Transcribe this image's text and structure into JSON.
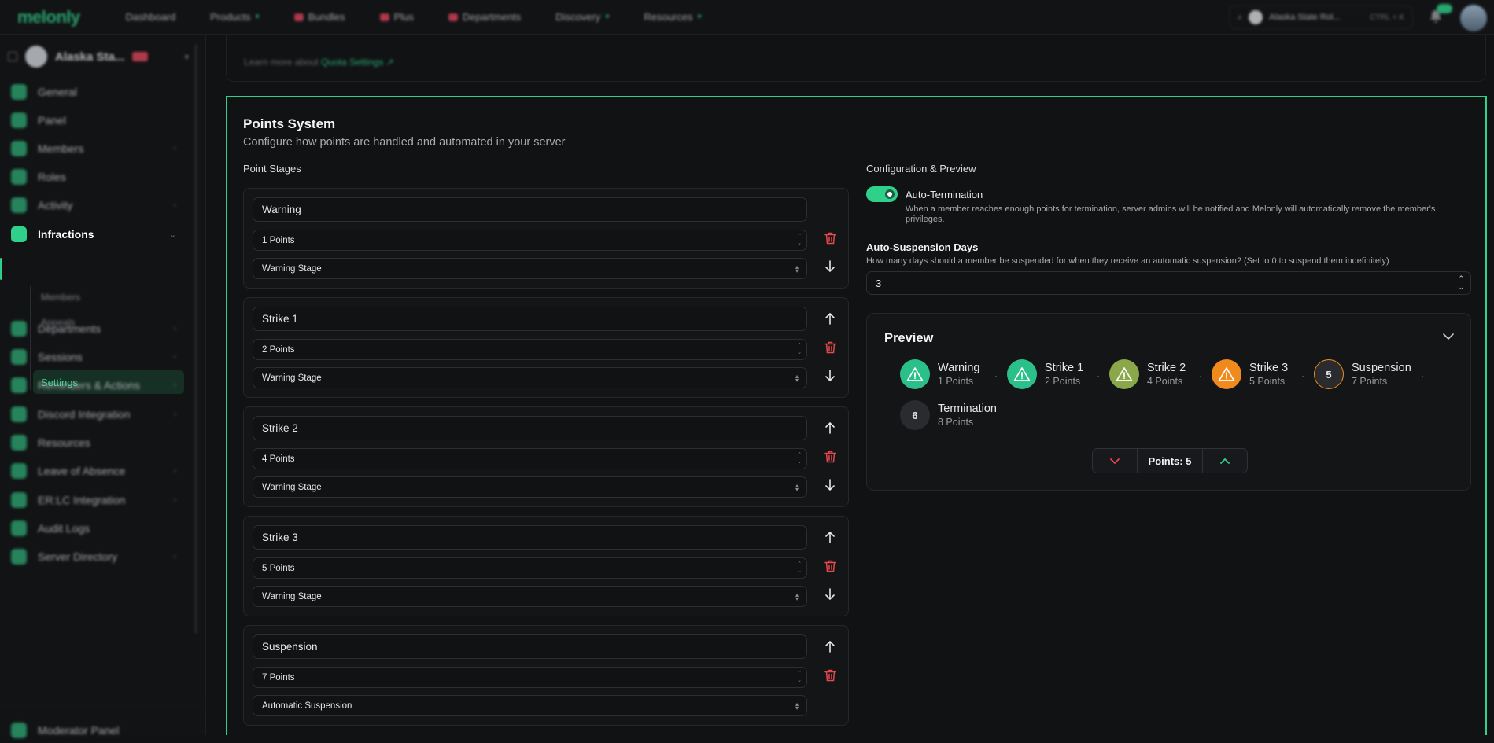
{
  "nav": {
    "logo": "melonly",
    "items": [
      {
        "label": "Dashboard"
      },
      {
        "label": "Products",
        "dropdown": true
      },
      {
        "label": "Bundles"
      },
      {
        "label": "Plus"
      },
      {
        "label": "Departments"
      },
      {
        "label": "Discovery",
        "dropdown": true
      },
      {
        "label": "Resources",
        "dropdown": true
      }
    ],
    "search": {
      "server": "Alaska State Rol...",
      "shortcut": "CTRL + K"
    }
  },
  "sidebar": {
    "server_name": "Alaska Sta...",
    "items": [
      {
        "label": "General"
      },
      {
        "label": "Panel"
      },
      {
        "label": "Members"
      },
      {
        "label": "Roles"
      },
      {
        "label": "Activity"
      },
      {
        "label": "Infractions"
      },
      {
        "label": "Departments"
      },
      {
        "label": "Sessions"
      },
      {
        "label": "Reminders & Actions"
      },
      {
        "label": "Discord Integration"
      },
      {
        "label": "Resources"
      },
      {
        "label": "Leave of Absence"
      },
      {
        "label": "ER:LC Integration"
      },
      {
        "label": "Audit Logs"
      },
      {
        "label": "Server Directory"
      }
    ],
    "sub_items": [
      "Members",
      "Appeals",
      "Settings"
    ],
    "footer": "Moderator Panel"
  },
  "quota": {
    "text": "Learn more about ",
    "link": "Quota Settings"
  },
  "points": {
    "title": "Points System",
    "subtitle": "Configure how points are handled and automated in your server",
    "stages_label": "Point Stages",
    "stages": [
      {
        "name": "Warning",
        "points": "1 Points",
        "type": "Warning Stage"
      },
      {
        "name": "Strike 1",
        "points": "2 Points",
        "type": "Warning Stage"
      },
      {
        "name": "Strike 2",
        "points": "4 Points",
        "type": "Warning Stage"
      },
      {
        "name": "Strike 3",
        "points": "5 Points",
        "type": "Warning Stage"
      },
      {
        "name": "Suspension",
        "points": "7 Points",
        "type": "Automatic Suspension"
      }
    ],
    "config_label": "Configuration & Preview",
    "auto_termination": {
      "label": "Auto-Termination",
      "enabled": true,
      "help": "When a member reaches enough points for termination, server admins will be notified and Melonly will automatically remove the member's privileges."
    },
    "auto_suspension": {
      "label": "Auto-Suspension Days",
      "help": "How many days should a member be suspended for when they receive an automatic suspension? (Set to 0 to suspend them indefinitely)",
      "value": "3"
    },
    "preview": {
      "title": "Preview",
      "stages": [
        {
          "name": "Warning",
          "points": "1 Points",
          "marker": "warning-icon",
          "color": "#2bbf8a"
        },
        {
          "name": "Strike 1",
          "points": "2 Points",
          "marker": "warning-icon",
          "color": "#2bbf8a"
        },
        {
          "name": "Strike 2",
          "points": "4 Points",
          "marker": "warning-icon",
          "color": "#8aa84a"
        },
        {
          "name": "Strike 3",
          "points": "5 Points",
          "marker": "warning-icon",
          "color": "#f08a1c"
        },
        {
          "name": "Suspension",
          "points": "7 Points",
          "marker": "5",
          "color": "#2a2b2f"
        },
        {
          "name": "Termination",
          "points": "8 Points",
          "marker": "6",
          "color": "#2a2b2f"
        }
      ],
      "points_label": "Points: 5"
    }
  },
  "colors": {
    "accent": "#2fd08a",
    "danger": "#e5484d",
    "suspension_ring": "#f08a1c"
  }
}
